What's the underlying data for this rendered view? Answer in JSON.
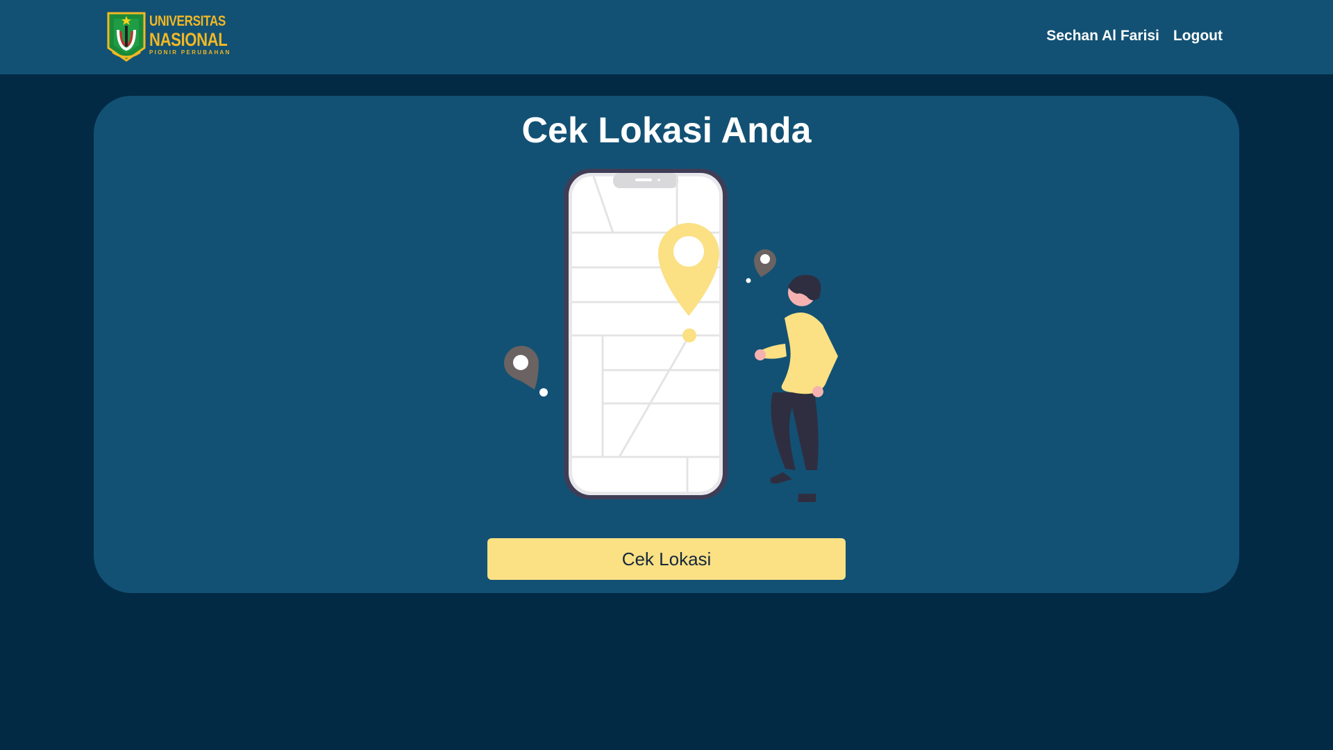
{
  "header": {
    "logo": {
      "line1": "UNIVERSITAS",
      "line2": "NASIONAL",
      "line3": "PIONIR PERUBAHAN",
      "icon": "university-crest-icon"
    },
    "user_name": "Sechan Al Farisi",
    "logout_label": "Logout"
  },
  "main": {
    "title": "Cek Lokasi Anda",
    "illustration": "phone-map-location-person-illustration",
    "button_label": "Cek Lokasi"
  },
  "colors": {
    "page_background": "#032a45",
    "navbar_background": "#125174",
    "card_background": "#125174",
    "button_background": "#fbe084",
    "logo_text": "#f2b823",
    "pin_yellow": "#fbe084",
    "pin_gray": "#6b6262"
  }
}
